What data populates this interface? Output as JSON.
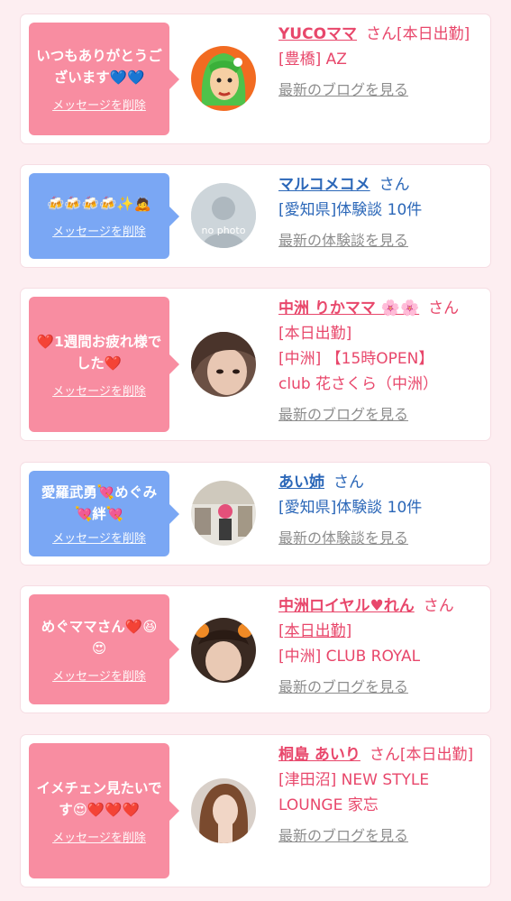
{
  "delete_label": "メッセージを削除",
  "san": "さん",
  "colors": {
    "pink_bubble": "#f88da1",
    "blue_bubble": "#7aa7f4",
    "pink_text": "#e8476b",
    "blue_text": "#2b67b8",
    "link": "#8d8d8d"
  },
  "cards": [
    {
      "message": "いつもありがとうございます💙💙",
      "name": "YUCOママ",
      "status": "[本日出勤]",
      "detail1": "[豊橋] AZ",
      "detail2": "",
      "link": "最新のブログを見る"
    },
    {
      "message": "🍻🍻🍻🍻✨🙇",
      "name": "マルコメコメ",
      "status": "",
      "detail1": "[愛知県]体験談 10件",
      "detail2": "",
      "link": "最新の体験談を見る",
      "avatar_text": "no photo"
    },
    {
      "message": "❤️1週間お疲れ様でした❤️",
      "name": "中洲 りかママ 🌸🌸",
      "status": "[本日出勤]",
      "detail1": "[中洲] 【15時OPEN】",
      "detail2": "club 花さくら（中洲）",
      "link": "最新のブログを見る"
    },
    {
      "message": "愛羅武勇💘めぐみ💘絆💘",
      "name": "あい姉",
      "status": "",
      "detail1": "[愛知県]体験談 10件",
      "detail2": "",
      "link": "最新の体験談を見る"
    },
    {
      "message": "めぐママさん❤️😆😍",
      "name": "中洲ロイヤル♥れん",
      "status": "[本日出勤]",
      "detail1": "[中洲] CLUB ROYAL",
      "detail2": "",
      "link": "最新のブログを見る"
    },
    {
      "message": "イメチェン見たいです😍❤️❤️❤️",
      "name": "桐島 あいり",
      "status": "[本日出勤]",
      "detail1": "[津田沼] NEW STYLE",
      "detail2": "LOUNGE 家忘",
      "link": "最新のブログを見る"
    }
  ]
}
